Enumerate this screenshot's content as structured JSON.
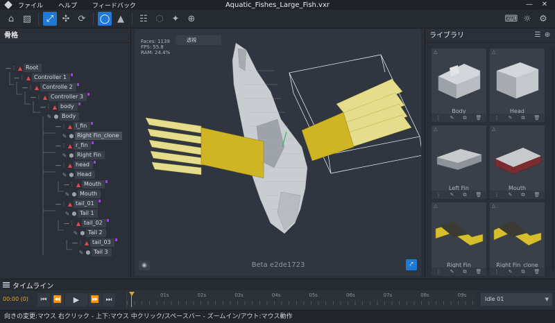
{
  "titlebar": {
    "menu": [
      "ファイル",
      "ヘルプ",
      "フィードバック"
    ],
    "document_title": "Aquatic_Fishes_Large_Fish.vxr"
  },
  "toolbar": {
    "left_icons": [
      "home-icon",
      "save-icon",
      "scale-icon",
      "move-icon",
      "rotate-icon",
      "bone-view-icon",
      "mesh-view-icon",
      "hierarchy-icon",
      "cube-icon",
      "pivot-icon",
      "target-icon"
    ],
    "right_icons": [
      "keyboard-icon",
      "light-icon",
      "settings-icon"
    ]
  },
  "skeleton": {
    "title": "骨格",
    "nodes": [
      {
        "label": "Root",
        "type": "bone"
      },
      {
        "label": "Controller 1",
        "type": "bone"
      },
      {
        "label": "Controlle 2",
        "type": "bone"
      },
      {
        "label": "Controller 3",
        "type": "bone"
      },
      {
        "label": "body",
        "type": "bone"
      },
      {
        "label": "Body",
        "type": "mesh"
      },
      {
        "label": "l_fin",
        "type": "bone"
      },
      {
        "label": "Right Fin_clone",
        "type": "mesh"
      },
      {
        "label": "r_fin",
        "type": "bone"
      },
      {
        "label": "Right Fin",
        "type": "mesh"
      },
      {
        "label": "head",
        "type": "bone"
      },
      {
        "label": "Head",
        "type": "mesh"
      },
      {
        "label": "Mouth",
        "type": "bone"
      },
      {
        "label": "Mouth",
        "type": "mesh"
      },
      {
        "label": "tail_01",
        "type": "bone"
      },
      {
        "label": "Tail 1",
        "type": "mesh"
      },
      {
        "label": "tail_02",
        "type": "bone"
      },
      {
        "label": "Tail 2",
        "type": "mesh"
      },
      {
        "label": "tail_03",
        "type": "bone"
      },
      {
        "label": "Tail 3",
        "type": "mesh"
      }
    ]
  },
  "viewport": {
    "faces": "Faces: 1139",
    "fps": "FPS: 55.8",
    "ram": "RAM: 24.4%",
    "view_mode": "透視",
    "version": "Beta e2de1723"
  },
  "library": {
    "title": "ライブラリ",
    "items": [
      {
        "name": "Body"
      },
      {
        "name": "Head"
      },
      {
        "name": "Left Fin"
      },
      {
        "name": "Mouth"
      },
      {
        "name": "Right Fin"
      },
      {
        "name": "Right Fin_clone"
      }
    ]
  },
  "timeline": {
    "title": "タイムライン",
    "timecode": "00:00 (0)",
    "ticks": [
      "01s",
      "02s",
      "03s",
      "04s",
      "05s",
      "06s",
      "07s",
      "08s",
      "09s"
    ],
    "animation": "Idle 01"
  },
  "status": {
    "text": "向きの変更:マウス 右クリック - 上下:マウス 中クリック/スペースバー - ズームイン/アウト:マウス動作"
  },
  "colors": {
    "accent": "#1f7ad6",
    "bone": "#e5484d",
    "fin": "#d9c23a",
    "body": "#c9ccd0",
    "playhead": "#e0a62a"
  }
}
